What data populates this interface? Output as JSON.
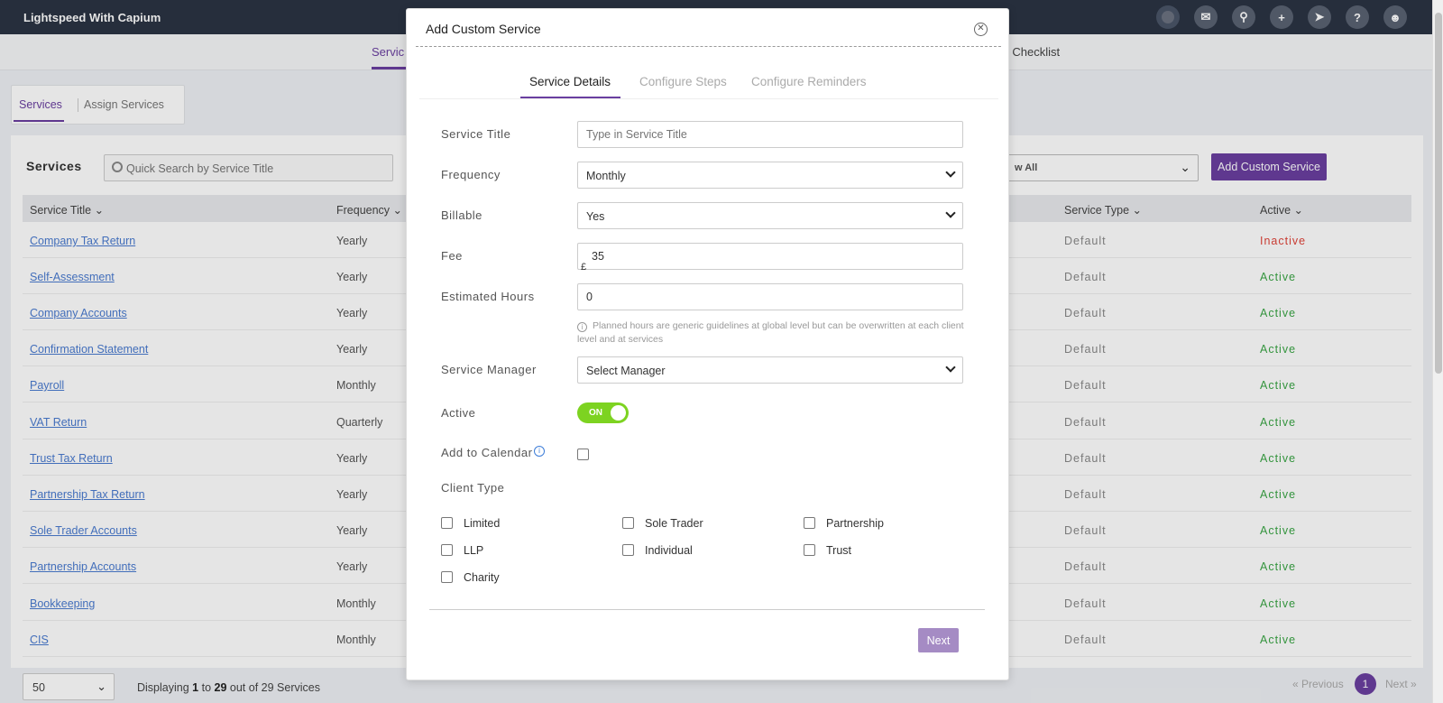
{
  "app": {
    "title": "Lightspeed With Capium"
  },
  "topbar_icons": [
    "avatar-dot-icon",
    "megaphone-icon",
    "search-icon",
    "plus-icon",
    "rocket-icon",
    "help-icon",
    "user-icon"
  ],
  "nav": {
    "services_label": "Servic",
    "checklist_label": "L Checklist"
  },
  "subtabs": {
    "services": "Services",
    "assign": "Assign Services"
  },
  "services_panel": {
    "title": "Services",
    "search_placeholder": "Quick Search by Service Title",
    "filter_value": "w All",
    "add_button": "Add Custom Service",
    "columns": {
      "title": "Service Title",
      "frequency": "Frequency",
      "service_type": "Service Type",
      "active": "Active"
    },
    "rows": [
      {
        "title": "Company Tax Return",
        "frequency": "Yearly",
        "type": "Default",
        "status": "Inactive"
      },
      {
        "title": "Self-Assessment",
        "frequency": "Yearly",
        "type": "Default",
        "status": "Active"
      },
      {
        "title": "Company Accounts",
        "frequency": "Yearly",
        "type": "Default",
        "status": "Active"
      },
      {
        "title": "Confirmation Statement",
        "frequency": "Yearly",
        "type": "Default",
        "status": "Active"
      },
      {
        "title": "Payroll",
        "frequency": "Monthly",
        "type": "Default",
        "status": "Active"
      },
      {
        "title": "VAT Return",
        "frequency": "Quarterly",
        "type": "Default",
        "status": "Active"
      },
      {
        "title": "Trust Tax Return",
        "frequency": "Yearly",
        "type": "Default",
        "status": "Active"
      },
      {
        "title": "Partnership Tax Return",
        "frequency": "Yearly",
        "type": "Default",
        "status": "Active"
      },
      {
        "title": "Sole Trader Accounts",
        "frequency": "Yearly",
        "type": "Default",
        "status": "Active"
      },
      {
        "title": "Partnership Accounts",
        "frequency": "Yearly",
        "type": "Default",
        "status": "Active"
      },
      {
        "title": "Bookkeeping",
        "frequency": "Monthly",
        "type": "Default",
        "status": "Active"
      },
      {
        "title": "CIS",
        "frequency": "Monthly",
        "type": "Default",
        "status": "Active"
      }
    ]
  },
  "footer": {
    "page_size": "50",
    "displaying_prefix": "Displaying",
    "from": "1",
    "to_word": "to",
    "to": "29",
    "suffix": "out of 29 Services",
    "prev": "«  Previous",
    "page": "1",
    "next": "Next  »"
  },
  "modal": {
    "title": "Add Custom Service",
    "tabs": {
      "details": "Service Details",
      "steps": "Configure Steps",
      "reminders": "Configure Reminders"
    },
    "fields": {
      "service_title_label": "Service Title",
      "service_title_placeholder": "Type in Service Title",
      "frequency_label": "Frequency",
      "frequency_value": "Monthly",
      "billable_label": "Billable",
      "billable_value": "Yes",
      "fee_label": "Fee",
      "fee_currency": "£",
      "fee_value": "35",
      "hours_label": "Estimated Hours",
      "hours_value": "0",
      "hint": "Planned hours are generic guidelines at global level but can be overwritten at each client level and at services",
      "manager_label": "Service Manager",
      "manager_value": "Select Manager",
      "active_label": "Active",
      "active_toggle": "ON",
      "calendar_label": "Add to Calendar",
      "client_type_label": "Client Type"
    },
    "client_types": [
      "Limited",
      "Sole Trader",
      "Partnership",
      "LLP",
      "Individual",
      "Trust",
      "Charity"
    ],
    "next_button": "Next"
  }
}
